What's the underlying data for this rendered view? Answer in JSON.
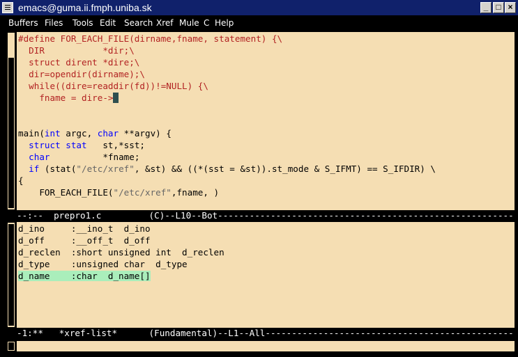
{
  "window": {
    "title": "emacs@guma.ii.fmph.uniba.sk",
    "btn_min": "_",
    "btn_max": "□",
    "btn_close": "×"
  },
  "menu": [
    "Buffers",
    "Files",
    "Tools",
    "Edit",
    "Search",
    "Xref",
    "Mule",
    "C",
    "Help"
  ],
  "editor": {
    "lines": [
      [
        [
          "pp",
          "#define FOR_EACH_FILE(dirname,fname, statement) {\\"
        ]
      ],
      [
        [
          "pp",
          "  DIR           *dir;\\"
        ]
      ],
      [
        [
          "pp",
          "  struct dirent *dire;\\"
        ]
      ],
      [
        [
          "pp",
          "  dir=opendir(dirname);\\"
        ]
      ],
      [
        [
          "pp",
          "  while((dire=readdir(fd))!=NULL) {\\"
        ]
      ],
      [
        [
          "pp",
          "    fname = dire->"
        ]
      ],
      [
        [
          "t",
          ""
        ]
      ],
      [
        [
          "t",
          ""
        ]
      ],
      [
        [
          "t",
          "main("
        ],
        [
          "kw",
          "int"
        ],
        [
          "t",
          " argc, "
        ],
        [
          "kw",
          "char"
        ],
        [
          "t",
          " **argv) {"
        ]
      ],
      [
        [
          "t",
          "  "
        ],
        [
          "kw",
          "struct stat"
        ],
        [
          "t",
          "   st,*sst;"
        ]
      ],
      [
        [
          "t",
          "  "
        ],
        [
          "kw",
          "char"
        ],
        [
          "t",
          "          *fname;"
        ]
      ],
      [
        [
          "t",
          "  "
        ],
        [
          "kw",
          "if"
        ],
        [
          "t",
          " (stat("
        ],
        [
          "str",
          "\"/etc/xref\""
        ],
        [
          "t",
          ", &st) && ((*(sst = &st)).st_mode & S_IFMT) == S_IFDIR) \\"
        ]
      ],
      [
        [
          "t",
          "{"
        ]
      ],
      [
        [
          "t",
          "    FOR_EACH_FILE("
        ],
        [
          "str",
          "\"/etc/xref\""
        ],
        [
          "t",
          ",fname, )"
        ]
      ]
    ],
    "cursor_line": 5
  },
  "modeline_top": "--:--  prepro1.c         (C)--L10--Bot-------------------------------------------------------------------------------",
  "xref_list": [
    "d_ino     :__ino_t  d_ino",
    "d_off     :__off_t  d_off",
    "d_reclen  :short unsigned int  d_reclen",
    "d_type    :unsigned char  d_type",
    "d_name    :char  d_name[]"
  ],
  "xref_selected": 4,
  "modeline_bottom": "-1:**   *xref-list*      (Fundamental)--L1--All-----------------------------------------------------------------------"
}
